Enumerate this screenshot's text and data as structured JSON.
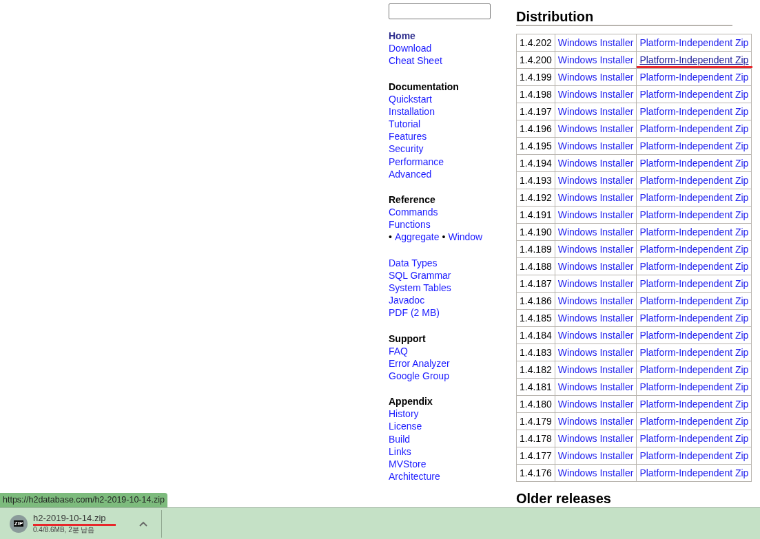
{
  "sidebar": {
    "groups": [
      {
        "items": [
          {
            "kind": "link",
            "label": "Home",
            "selected": true
          },
          {
            "kind": "link",
            "label": "Download",
            "selected": false
          },
          {
            "kind": "link",
            "label": "Cheat Sheet",
            "selected": false
          }
        ]
      },
      {
        "heading": "Documentation",
        "items": [
          {
            "kind": "link",
            "label": "Quickstart",
            "selected": false
          },
          {
            "kind": "link",
            "label": "Installation",
            "selected": false
          },
          {
            "kind": "link",
            "label": "Tutorial",
            "selected": false
          },
          {
            "kind": "link",
            "label": "Features",
            "selected": false
          },
          {
            "kind": "link",
            "label": "Security",
            "selected": false
          },
          {
            "kind": "link",
            "label": "Performance",
            "selected": false
          },
          {
            "kind": "link",
            "label": "Advanced",
            "selected": false
          }
        ]
      },
      {
        "heading": "Reference",
        "items": [
          {
            "kind": "link",
            "label": "Commands",
            "selected": false
          },
          {
            "kind": "link",
            "label": "Functions",
            "selected": false
          },
          {
            "kind": "bullets",
            "links": [
              {
                "bullet": "•",
                "label": "Aggregate"
              },
              {
                "bullet": "•",
                "label": "Window"
              }
            ]
          }
        ]
      },
      {
        "items": [
          {
            "kind": "link",
            "label": "Data Types",
            "selected": false
          },
          {
            "kind": "link",
            "label": "SQL Grammar",
            "selected": false
          },
          {
            "kind": "link",
            "label": "System Tables",
            "selected": false
          },
          {
            "kind": "link",
            "label": "Javadoc",
            "selected": false
          },
          {
            "kind": "link",
            "label": "PDF (2 MB)",
            "selected": false
          }
        ]
      },
      {
        "heading": "Support",
        "items": [
          {
            "kind": "link",
            "label": "FAQ",
            "selected": false
          },
          {
            "kind": "link",
            "label": "Error Analyzer",
            "selected": false
          },
          {
            "kind": "link",
            "label": "Google Group",
            "selected": false
          }
        ]
      },
      {
        "heading": "Appendix",
        "items": [
          {
            "kind": "link",
            "label": "History",
            "selected": false
          },
          {
            "kind": "link",
            "label": "License",
            "selected": false
          },
          {
            "kind": "link",
            "label": "Build",
            "selected": false
          },
          {
            "kind": "link",
            "label": "Links",
            "selected": false
          },
          {
            "kind": "link",
            "label": "MVStore",
            "selected": false
          },
          {
            "kind": "link",
            "label": "Architecture",
            "selected": false
          }
        ]
      }
    ]
  },
  "distribution": {
    "title": "Distribution",
    "rows": [
      {
        "version": "1.4.202",
        "installer": "Windows Installer",
        "zip": "Platform-Independent Zip",
        "highlighted": false
      },
      {
        "version": "1.4.200",
        "installer": "Windows Installer",
        "zip": "Platform-Independent Zip",
        "highlighted": true
      },
      {
        "version": "1.4.199",
        "installer": "Windows Installer",
        "zip": "Platform-Independent Zip",
        "highlighted": false
      },
      {
        "version": "1.4.198",
        "installer": "Windows Installer",
        "zip": "Platform-Independent Zip",
        "highlighted": false
      },
      {
        "version": "1.4.197",
        "installer": "Windows Installer",
        "zip": "Platform-Independent Zip",
        "highlighted": false
      },
      {
        "version": "1.4.196",
        "installer": "Windows Installer",
        "zip": "Platform-Independent Zip",
        "highlighted": false
      },
      {
        "version": "1.4.195",
        "installer": "Windows Installer",
        "zip": "Platform-Independent Zip",
        "highlighted": false
      },
      {
        "version": "1.4.194",
        "installer": "Windows Installer",
        "zip": "Platform-Independent Zip",
        "highlighted": false
      },
      {
        "version": "1.4.193",
        "installer": "Windows Installer",
        "zip": "Platform-Independent Zip",
        "highlighted": false
      },
      {
        "version": "1.4.192",
        "installer": "Windows Installer",
        "zip": "Platform-Independent Zip",
        "highlighted": false
      },
      {
        "version": "1.4.191",
        "installer": "Windows Installer",
        "zip": "Platform-Independent Zip",
        "highlighted": false
      },
      {
        "version": "1.4.190",
        "installer": "Windows Installer",
        "zip": "Platform-Independent Zip",
        "highlighted": false
      },
      {
        "version": "1.4.189",
        "installer": "Windows Installer",
        "zip": "Platform-Independent Zip",
        "highlighted": false
      },
      {
        "version": "1.4.188",
        "installer": "Windows Installer",
        "zip": "Platform-Independent Zip",
        "highlighted": false
      },
      {
        "version": "1.4.187",
        "installer": "Windows Installer",
        "zip": "Platform-Independent Zip",
        "highlighted": false
      },
      {
        "version": "1.4.186",
        "installer": "Windows Installer",
        "zip": "Platform-Independent Zip",
        "highlighted": false
      },
      {
        "version": "1.4.185",
        "installer": "Windows Installer",
        "zip": "Platform-Independent Zip",
        "highlighted": false
      },
      {
        "version": "1.4.184",
        "installer": "Windows Installer",
        "zip": "Platform-Independent Zip",
        "highlighted": false
      },
      {
        "version": "1.4.183",
        "installer": "Windows Installer",
        "zip": "Platform-Independent Zip",
        "highlighted": false
      },
      {
        "version": "1.4.182",
        "installer": "Windows Installer",
        "zip": "Platform-Independent Zip",
        "highlighted": false
      },
      {
        "version": "1.4.181",
        "installer": "Windows Installer",
        "zip": "Platform-Independent Zip",
        "highlighted": false
      },
      {
        "version": "1.4.180",
        "installer": "Windows Installer",
        "zip": "Platform-Independent Zip",
        "highlighted": false
      },
      {
        "version": "1.4.179",
        "installer": "Windows Installer",
        "zip": "Platform-Independent Zip",
        "highlighted": false
      },
      {
        "version": "1.4.178",
        "installer": "Windows Installer",
        "zip": "Platform-Independent Zip",
        "highlighted": false
      },
      {
        "version": "1.4.177",
        "installer": "Windows Installer",
        "zip": "Platform-Independent Zip",
        "highlighted": false
      },
      {
        "version": "1.4.176",
        "installer": "Windows Installer",
        "zip": "Platform-Independent Zip",
        "highlighted": false
      }
    ]
  },
  "older_releases": {
    "title": "Older releases"
  },
  "status_url": "https://h2database.com/h2-2019-10-14.zip",
  "download_bar": {
    "item": {
      "icon_text": "ZIP",
      "filename": "h2-2019-10-14.zip",
      "progress": "0.4/8.6MB, 2분 남음",
      "highlighted": true
    }
  }
}
